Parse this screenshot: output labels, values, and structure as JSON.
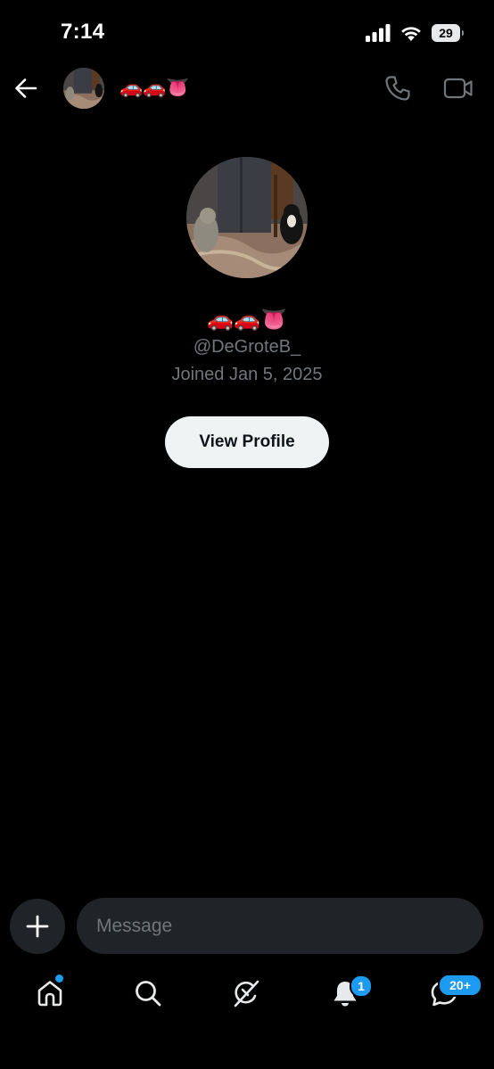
{
  "status_bar": {
    "time": "7:14",
    "battery": "29"
  },
  "header": {
    "display_name": "🚗🚗👅",
    "back_icon": "arrow-left-icon",
    "call_icon": "phone-icon",
    "video_icon": "video-camera-icon"
  },
  "profile": {
    "display_name": "🚗🚗👅",
    "handle": "@DeGroteB_",
    "joined": "Joined Jan 5, 2025",
    "view_profile_label": "View Profile"
  },
  "composer": {
    "placeholder": "Message",
    "add_icon": "plus-icon"
  },
  "tab_bar": {
    "items": [
      {
        "name": "home",
        "icon": "home-icon",
        "has_dot": true
      },
      {
        "name": "search",
        "icon": "search-icon"
      },
      {
        "name": "grok",
        "icon": "grok-icon"
      },
      {
        "name": "notifications",
        "icon": "bell-icon",
        "badge": "1"
      },
      {
        "name": "messages",
        "icon": "messages-icon",
        "badge": "20+"
      }
    ]
  },
  "colors": {
    "background": "#000000",
    "accent": "#1d9bf0",
    "muted_text": "#71767b",
    "input_bg": "#202327",
    "button_bg": "#eff3f4"
  }
}
